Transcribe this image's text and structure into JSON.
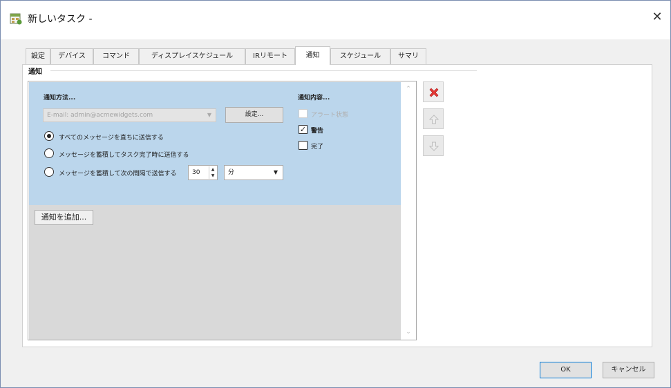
{
  "window": {
    "title": "新しいタスク -"
  },
  "tabs": [
    {
      "label": "設定"
    },
    {
      "label": "デバイス"
    },
    {
      "label": "コマンド"
    },
    {
      "label": "ディスプレイスケジュール"
    },
    {
      "label": "IRリモート"
    },
    {
      "label": "通知"
    },
    {
      "label": "スケジュール"
    },
    {
      "label": "サマリ"
    }
  ],
  "active_tab": "通知",
  "notify": {
    "group_title": "通知",
    "method_label": "通知方法...",
    "method_value": "E-mail: admin@acmewidgets.com",
    "setting_button": "設定...",
    "radios": [
      {
        "label": "すべてのメッセージを直ちに送信する",
        "selected": true
      },
      {
        "label": "メッセージを蓄積してタスク完了時に送信する",
        "selected": false
      },
      {
        "label": "メッセージを蓄積して次の間隔で送信する",
        "selected": false
      }
    ],
    "interval_value": "30",
    "interval_unit": "分",
    "content_label": "通知内容...",
    "checkboxes": [
      {
        "label": "アラート状態",
        "checked": false,
        "disabled": true
      },
      {
        "label": "警告",
        "checked": true,
        "disabled": false
      },
      {
        "label": "完了",
        "checked": false,
        "disabled": false
      }
    ],
    "add_button": "通知を追加..."
  },
  "footer": {
    "ok": "OK",
    "cancel": "キャンセル"
  },
  "colors": {
    "selected_item": "#bbd6ec",
    "list_empty": "#d9d9d9",
    "delete_icon": "#e53935"
  }
}
